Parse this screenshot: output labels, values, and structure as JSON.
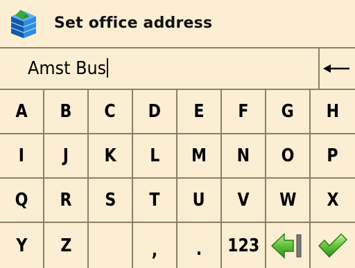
{
  "header": {
    "title": "Set office address",
    "logo_icon": "folder-globe-icon"
  },
  "input": {
    "value": "Amst Bus"
  },
  "icons": {
    "backspace": "backspace-arrow-icon",
    "back": "green-left-arrow-icon",
    "confirm": "green-checkmark-icon"
  },
  "keyboard": {
    "row1": [
      "A",
      "B",
      "C",
      "D",
      "E",
      "F",
      "G",
      "H"
    ],
    "row2": [
      "I",
      "J",
      "K",
      "L",
      "M",
      "N",
      "O",
      "P"
    ],
    "row3": [
      "Q",
      "R",
      "S",
      "T",
      "U",
      "V",
      "W",
      "X"
    ],
    "row4": [
      "Y",
      "Z",
      "",
      ",",
      ".",
      "123"
    ]
  },
  "colors": {
    "background": "#fbeed3",
    "divider": "#8a7f6b",
    "accent_green": "#5fbf3a"
  }
}
